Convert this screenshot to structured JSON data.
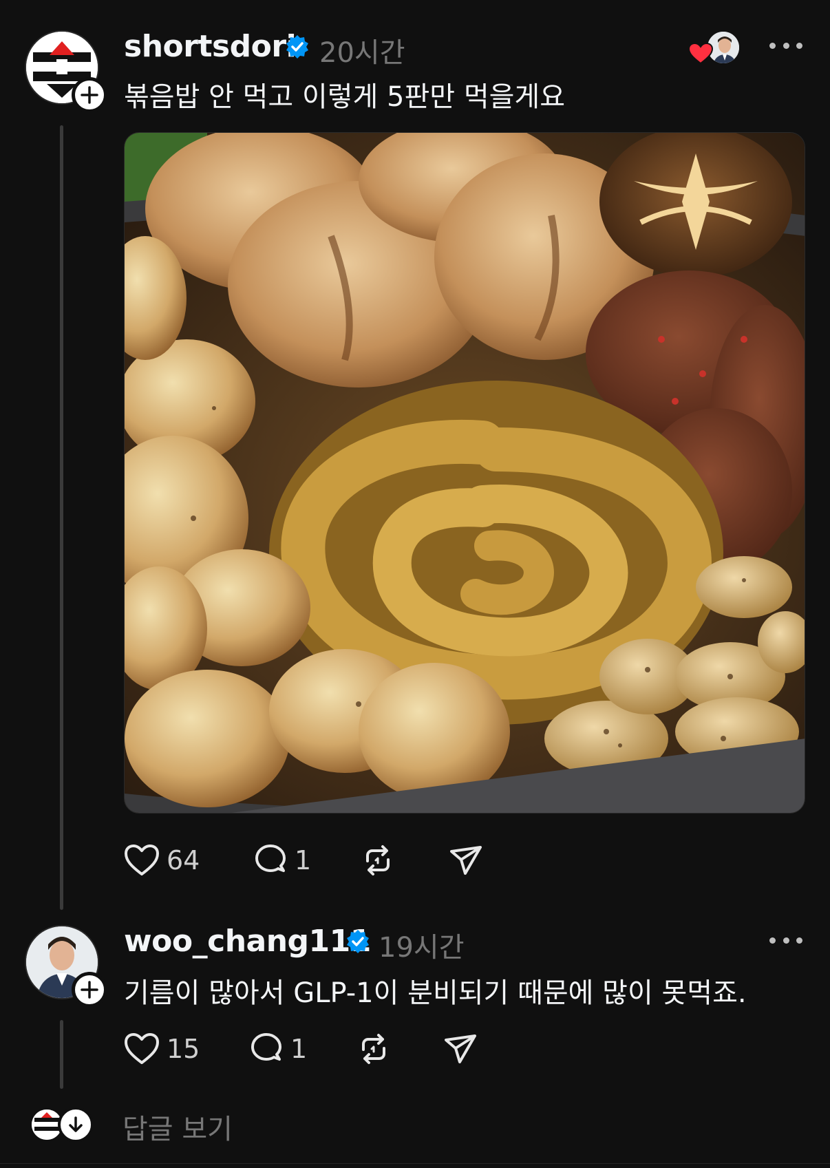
{
  "post": {
    "username": "shortsdori",
    "time": "20시간",
    "text": "볶음밥 안 먹고 이렇게 5판만 먹을게요",
    "likes": "64",
    "comments": "1"
  },
  "reply": {
    "username": "woo_chang111",
    "time": "19시간",
    "text": "기름이 많아서 GLP-1이 분비되기 때문에 많이 못먹죠.",
    "likes": "15",
    "comments": "1"
  },
  "footer": {
    "view_replies": "답글 보기"
  },
  "icons": [
    "avatar-shortsdori",
    "follow-plus-icon",
    "verified-icon",
    "more-icon",
    "heart-icon",
    "comment-icon",
    "repost-icon",
    "share-icon",
    "liked-by-heart-icon",
    "expand-replies-icon"
  ],
  "colors": {
    "accent_verified": "#0095f6",
    "like_red": "#ff3040",
    "background": "#101010",
    "muted": "#777777"
  }
}
